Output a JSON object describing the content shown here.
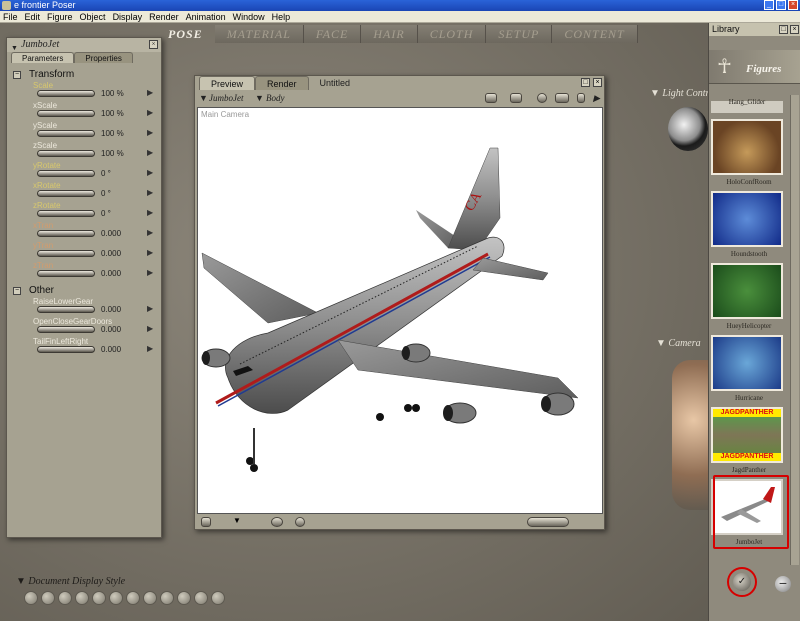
{
  "window": {
    "title": "e frontier Poser"
  },
  "menu": [
    "File",
    "Edit",
    "Figure",
    "Object",
    "Display",
    "Render",
    "Animation",
    "Window",
    "Help"
  ],
  "mode_tabs": [
    "POSE",
    "MATERIAL",
    "FACE",
    "HAIR",
    "CLOTH",
    "SETUP",
    "CONTENT"
  ],
  "params_panel": {
    "title": "JumboJet",
    "tabs": [
      "Parameters",
      "Properties"
    ],
    "sections": [
      {
        "name": "Transform",
        "params": [
          {
            "label": "Scale",
            "value": "100 %"
          },
          {
            "label": "xScale",
            "value": "100 %"
          },
          {
            "label": "yScale",
            "value": "100 %"
          },
          {
            "label": "zScale",
            "value": "100 %"
          },
          {
            "label": "yRotate",
            "value": "0 °"
          },
          {
            "label": "xRotate",
            "value": "0 °"
          },
          {
            "label": "zRotate",
            "value": "0 °"
          },
          {
            "label": "xTran",
            "value": "0.000"
          },
          {
            "label": "yTran",
            "value": "0.000"
          },
          {
            "label": "zTran",
            "value": "0.000"
          }
        ]
      },
      {
        "name": "Other",
        "params": [
          {
            "label": "RaiseLowerGear",
            "value": "0.000"
          },
          {
            "label": "OpenCloseGearDoors",
            "value": "0.000"
          },
          {
            "label": "TailFinLeftRight",
            "value": "0.000"
          }
        ]
      }
    ]
  },
  "document": {
    "tabs": [
      "Preview",
      "Render",
      "Untitled"
    ],
    "figure_menu": "JumboJet",
    "element_menu": "Body",
    "camera_label": "Main Camera"
  },
  "document_display_style": "Document Display Style",
  "light_controls_label": "Light Controls",
  "camera_label": "Camera",
  "library": {
    "title": "Library",
    "category": "Figures",
    "items": [
      {
        "label": "Hang_Glider"
      },
      {
        "label": "HoloConfRoom"
      },
      {
        "label": "Houndstooth"
      },
      {
        "label": "HueyHelicopter"
      },
      {
        "label": "Hurricane"
      },
      {
        "label": "JagdPanther",
        "banner": "JAGDPANTHER"
      },
      {
        "label": "JumboJet"
      }
    ]
  },
  "colors": {
    "selection": "#d60000",
    "titlebar": "#2a63d8"
  }
}
